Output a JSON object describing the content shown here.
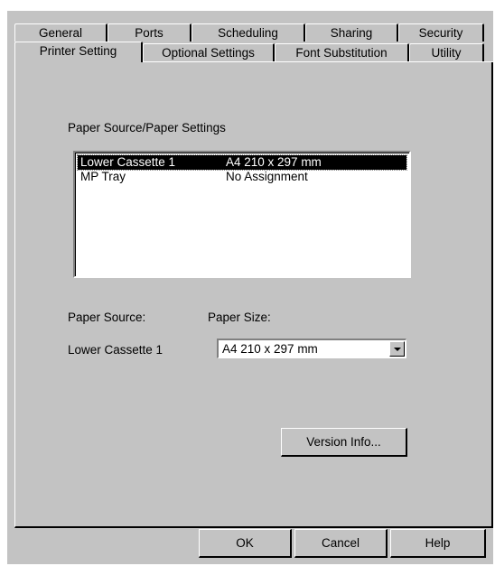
{
  "tabs": {
    "back_row": [
      "General",
      "Ports",
      "Scheduling",
      "Sharing",
      "Security"
    ],
    "front_row": [
      "Printer Setting",
      "Optional Settings",
      "Font Substitution",
      "Utility"
    ],
    "active": "Printer Setting"
  },
  "paper_settings": {
    "group_label": "Paper Source/Paper Settings",
    "columns": [
      "Paper Source",
      "Paper Size"
    ],
    "rows": [
      {
        "source": "Lower Cassette 1",
        "size": "A4 210 x 297 mm",
        "selected": true
      },
      {
        "source": "MP Tray",
        "size": "No Assignment",
        "selected": false
      }
    ]
  },
  "fields": {
    "paper_source_label": "Paper Source:",
    "paper_size_label": "Paper Size:",
    "paper_source_value": "Lower Cassette 1",
    "paper_size_value": "A4 210 x 297 mm"
  },
  "buttons": {
    "version_info": "Version Info...",
    "ok": "OK",
    "cancel": "Cancel",
    "help": "Help"
  }
}
